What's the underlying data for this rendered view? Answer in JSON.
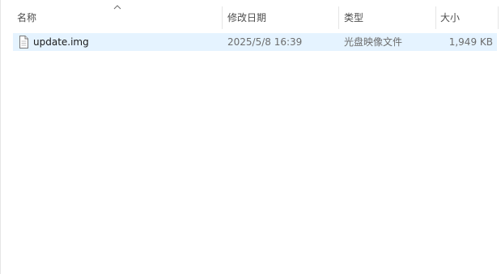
{
  "columns": {
    "name": "名称",
    "modified": "修改日期",
    "type": "类型",
    "size": "大小"
  },
  "sort": {
    "column": "name",
    "direction": "ascending",
    "icon": "chevron-up-icon"
  },
  "files": [
    {
      "icon": "file-icon",
      "name": "update.img",
      "modified": "2025/5/8 16:39",
      "type": "光盘映像文件",
      "size": "1,949 KB",
      "selected": true
    }
  ],
  "colors": {
    "selection": "#e5f3ff",
    "header_text": "#4d4d4d",
    "muted_text": "#6d6d6d",
    "divider": "#e5e5e5"
  }
}
